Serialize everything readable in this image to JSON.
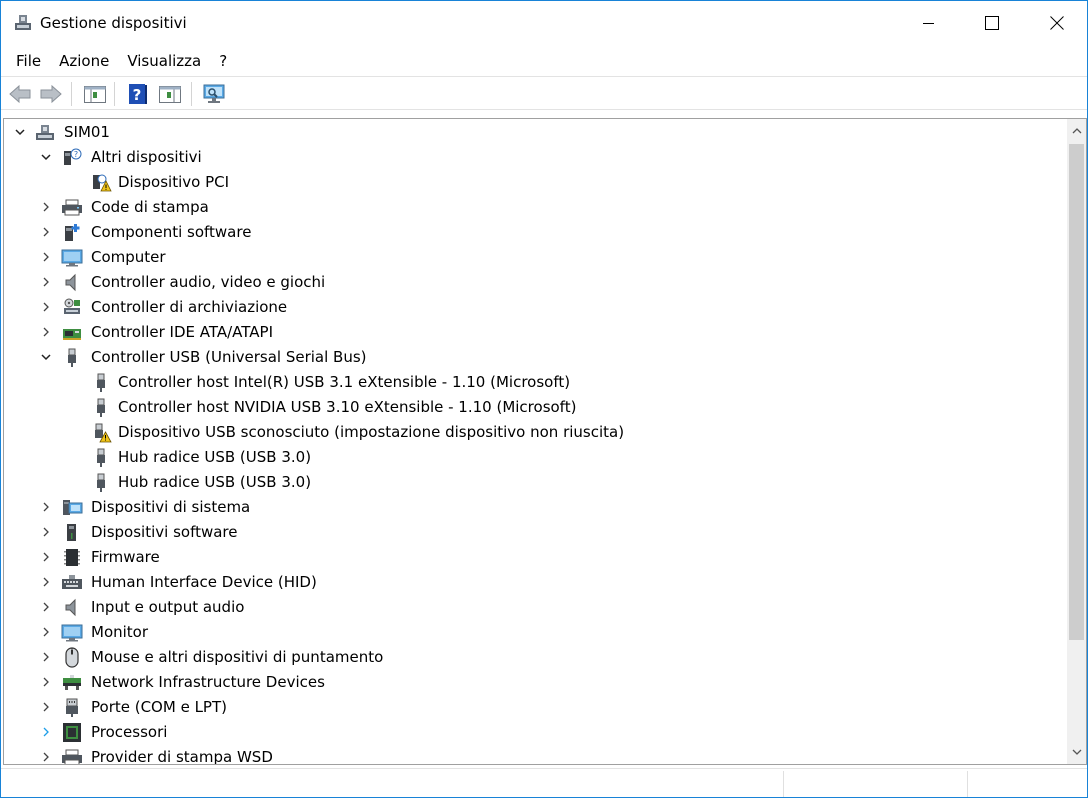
{
  "window": {
    "title": "Gestione dispositivi",
    "accent": "#1883d7"
  },
  "menu": [
    "File",
    "Azione",
    "Visualizza",
    "?"
  ],
  "toolbar": [
    {
      "icon": "back-arrow-icon"
    },
    {
      "icon": "forward-arrow-icon"
    },
    {
      "icon": "show-hide-console-tree-icon"
    },
    {
      "icon": "help-icon"
    },
    {
      "icon": "properties-icon"
    },
    {
      "icon": "scan-hardware-changes-icon"
    }
  ],
  "tree": {
    "root": "SIM01",
    "items": [
      {
        "label": "Altri dispositivi",
        "expanded": true,
        "icon": "unknown-device-icon",
        "children": [
          {
            "label": "Dispositivo PCI",
            "icon": "warning-device-icon"
          }
        ]
      },
      {
        "label": "Code di stampa",
        "icon": "printer-icon"
      },
      {
        "label": "Componenti software",
        "icon": "software-component-icon"
      },
      {
        "label": "Computer",
        "icon": "computer-icon"
      },
      {
        "label": "Controller audio, video e giochi",
        "icon": "speaker-icon"
      },
      {
        "label": "Controller di archiviazione",
        "icon": "storage-controller-icon"
      },
      {
        "label": "Controller IDE ATA/ATAPI",
        "icon": "ide-controller-icon"
      },
      {
        "label": "Controller USB (Universal Serial Bus)",
        "expanded": true,
        "icon": "usb-icon",
        "children": [
          {
            "label": "Controller host Intel(R) USB 3.1 eXtensible - 1.10 (Microsoft)",
            "icon": "usb-icon"
          },
          {
            "label": "Controller host NVIDIA USB 3.10 eXtensible - 1.10 (Microsoft)",
            "icon": "usb-icon"
          },
          {
            "label": "Dispositivo USB sconosciuto (impostazione dispositivo non riuscita)",
            "icon": "usb-warning-icon"
          },
          {
            "label": "Hub radice USB (USB 3.0)",
            "icon": "usb-icon"
          },
          {
            "label": "Hub radice USB (USB 3.0)",
            "icon": "usb-icon"
          }
        ]
      },
      {
        "label": "Dispositivi di sistema",
        "icon": "system-devices-icon"
      },
      {
        "label": "Dispositivi software",
        "icon": "software-device-icon"
      },
      {
        "label": "Firmware",
        "icon": "firmware-icon"
      },
      {
        "label": "Human Interface Device (HID)",
        "icon": "hid-icon"
      },
      {
        "label": "Input e output audio",
        "icon": "speaker-icon"
      },
      {
        "label": "Monitor",
        "icon": "monitor-icon"
      },
      {
        "label": "Mouse e altri dispositivi di puntamento",
        "icon": "mouse-icon"
      },
      {
        "label": "Network Infrastructure Devices",
        "icon": "network-infrastructure-icon"
      },
      {
        "label": "Porte (COM e LPT)",
        "icon": "port-icon"
      },
      {
        "label": "Processori",
        "icon": "processor-icon",
        "hovered": true
      },
      {
        "label": "Provider di stampa WSD",
        "icon": "wsd-print-icon"
      }
    ]
  }
}
